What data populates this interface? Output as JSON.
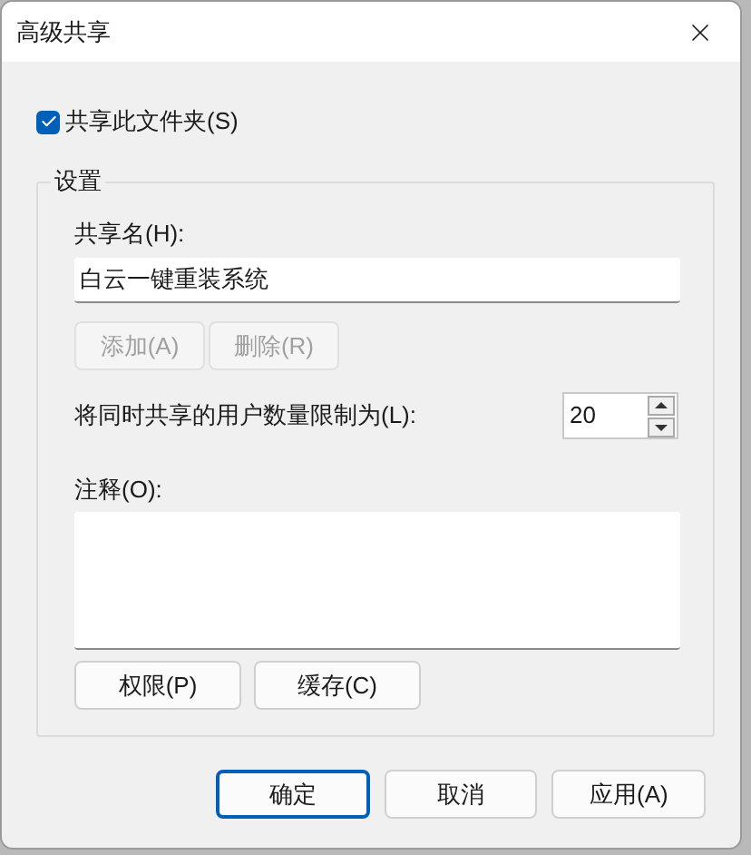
{
  "window": {
    "title": "高级共享"
  },
  "share_checkbox": {
    "label": "共享此文件夹(S)",
    "checked": true
  },
  "settings_group": {
    "title": "设置",
    "share_name": {
      "label": "共享名(H):",
      "value": "白云一键重装系统"
    },
    "name_buttons": [
      {
        "label": "添加(A)",
        "disabled": true
      },
      {
        "label": "删除(R)",
        "disabled": true
      }
    ],
    "user_limit": {
      "label": "将同时共享的用户数量限制为(L):",
      "value": "20"
    },
    "comment": {
      "label": "注释(O):"
    },
    "buttons": [
      {
        "label": "权限(P)"
      },
      {
        "label": "缓存(C)"
      }
    ]
  },
  "dialog_buttons": [
    {
      "label": "确定",
      "default": true
    },
    {
      "label": "取消",
      "default": false
    },
    {
      "label": "应用(A)",
      "default": false
    }
  ]
}
